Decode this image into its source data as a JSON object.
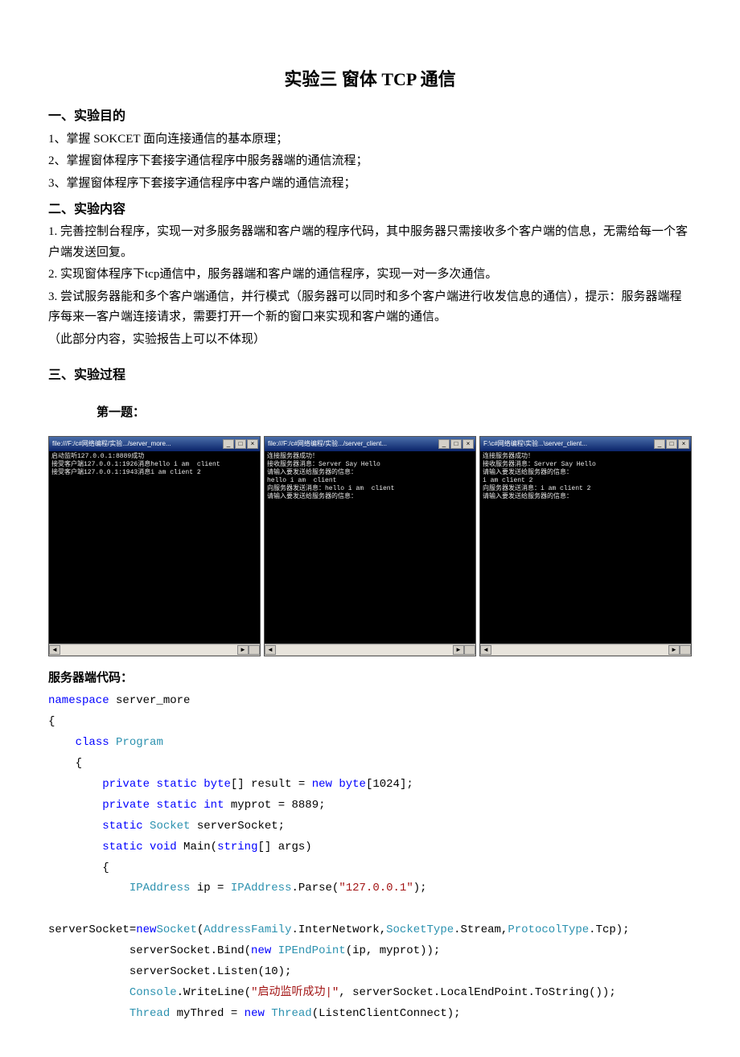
{
  "title": "实验三  窗体 TCP 通信",
  "s1": {
    "heading": "一、实验目的",
    "p1": "1、掌握 SOKCET 面向连接通信的基本原理；",
    "p2": "2、掌握窗体程序下套接字通信程序中服务器端的通信流程；",
    "p3": "3、掌握窗体程序下套接字通信程序中客户端的通信流程；"
  },
  "s2": {
    "heading": "二、实验内容",
    "p1": "1. 完善控制台程序，实现一对多服务器端和客户端的程序代码，其中服务器只需接收多个客户端的信息，无需给每一个客户端发送回复。",
    "p2": "2. 实现窗体程序下tcp通信中，服务器端和客户端的通信程序，实现一对一多次通信。",
    "p3a": "3. 尝试服务器能和多个客户端通信，并行模式（服务器可以同时和多个客户端进行收发信息的通信），提示：服务器端程序每来一客户端连接请求，需要打开一个新的窗口来实现和客户端的通信。",
    "p3b": "（此部分内容，实验报告上可以不体现）"
  },
  "s3": {
    "heading": "三、实验过程",
    "sub1": "第一题："
  },
  "consoles": [
    {
      "title": "file:///F:/c#网络编程/实验.../server_more...",
      "body": "启动监听127.0.0.1:8889成功\n接受客户端127.0.0.1:1926消息hello i am  client\n接受客户端127.0.0.1:1943消息i am client 2"
    },
    {
      "title": "file:///F:/c#网络编程/实验.../server_client...",
      "body": "连接服务器成功！\n接收服务器消息：Server Say Hello\n请输入要发送给服务器的信息：\nhello i am  client\n向服务器发送消息：hello i am  client\n请输入要发送给服务器的信息："
    },
    {
      "title": "F:\\c#网络编程\\实验...\\server_client...",
      "body": "连接服务器成功！\n接收服务器消息：Server Say Hello\n请输入要发送给服务器的信息：\ni am client 2\n向服务器发送消息：i am client 2\n请输入要发送给服务器的信息："
    }
  ],
  "codeHeading": "服务器端代码：",
  "code": {
    "ns": "namespace",
    "nsName": " server_more",
    "brO": "{",
    "class": "class",
    "className": "Program",
    "priv": "private",
    "stat": "static",
    "byte": "byte",
    "resDecl": "[] result = ",
    "new": "new",
    "byteArr": "[1024];",
    "int": "int",
    "myprot": " myprot = 8889;",
    "Socket": "Socket",
    "svSock": " serverSocket;",
    "void": "void",
    "Main": " Main(",
    "string": "string",
    "args": "[] args)",
    "IPAddress": "IPAddress",
    "ipEq": " ip = ",
    "Parse": ".Parse(",
    "ipStr": "\"127.0.0.1\"",
    "close": ");",
    "svAssign": "serverSocket=",
    "newKw": "new",
    "addrFam": "AddressFamily",
    "inter": ".InterNetwork,",
    "sockType": "SocketType",
    "stream": ".Stream,",
    "protoType": "ProtocolType",
    "tcp": ".Tcp);",
    "bind1": "            serverSocket.Bind(",
    "IPEndPoint": "IPEndPoint",
    "bind2": "(ip, myprot));",
    "listen": "            serverSocket.Listen(10);",
    "Console": "Console",
    "wrl1": ".WriteLine(",
    "launchStr": "\"启动监听成功|\"",
    "wrl2": ", serverSocket.LocalEndPoint.ToString());",
    "Thread": "Thread",
    "myThred": " myThred = ",
    "thrCtor": "(ListenClientConnect);"
  }
}
